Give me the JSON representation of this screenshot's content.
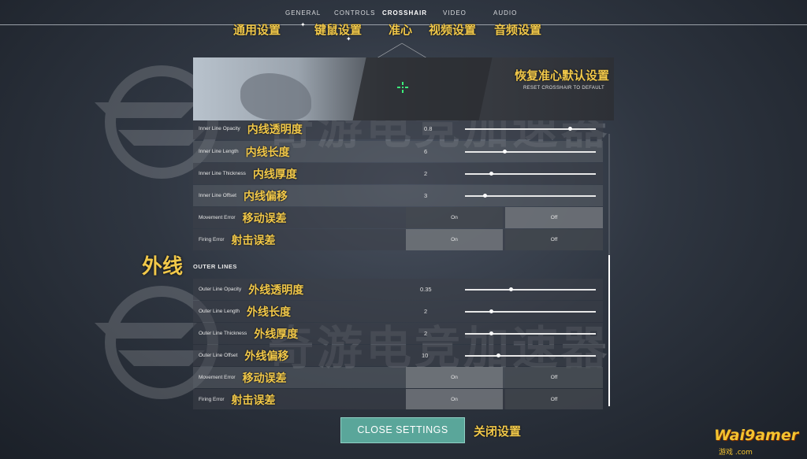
{
  "nav": {
    "tabs": [
      {
        "label": "GENERAL",
        "zh": "通用设置"
      },
      {
        "label": "CONTROLS",
        "zh": "键鼠设置"
      },
      {
        "label": "CROSSHAIR",
        "zh": "准心"
      },
      {
        "label": "VIDEO",
        "zh": "视频设置"
      },
      {
        "label": "AUDIO",
        "zh": "音频设置"
      }
    ],
    "active_tab": "CROSSHAIR"
  },
  "preview": {
    "reset_zh": "恢复准心默认设置",
    "reset_en": "RESET CROSSHAIR TO DEFAULT"
  },
  "inner_rows": [
    {
      "en": "Inner Line Opacity",
      "zh": "内线透明度",
      "value": "0.8",
      "level": 0.8
    },
    {
      "en": "Inner Line Length",
      "zh": "内线长度",
      "value": "6",
      "level": 0.3
    },
    {
      "en": "Inner Line Thickness",
      "zh": "内线厚度",
      "value": "2",
      "level": 0.2
    },
    {
      "en": "Inner Line Offset",
      "zh": "内线偏移",
      "value": "3",
      "level": 0.15
    }
  ],
  "inner_toggles": [
    {
      "en": "Movement Error",
      "zh": "移动误差",
      "on": "On",
      "off": "Off",
      "selected": "Off"
    },
    {
      "en": "Firing Error",
      "zh": "射击误差",
      "on": "On",
      "off": "Off",
      "selected": "On"
    }
  ],
  "outer_section": {
    "zh": "外线",
    "en": "OUTER LINES"
  },
  "outer_rows": [
    {
      "en": "Outer Line Opacity",
      "zh": "外线透明度",
      "value": "0.35",
      "level": 0.35
    },
    {
      "en": "Outer Line Length",
      "zh": "外线长度",
      "value": "2",
      "level": 0.2
    },
    {
      "en": "Outer Line Thickness",
      "zh": "外线厚度",
      "value": "2",
      "level": 0.2
    },
    {
      "en": "Outer Line Offset",
      "zh": "外线偏移",
      "value": "10",
      "level": 0.25
    }
  ],
  "outer_toggles": [
    {
      "en": "Movement Error",
      "zh": "移动误差",
      "on": "On",
      "off": "Off",
      "selected": "On"
    },
    {
      "en": "Firing Error",
      "zh": "射击误差",
      "on": "On",
      "off": "Off",
      "selected": "On"
    }
  ],
  "footer": {
    "close_label": "CLOSE SETTINGS",
    "close_zh": "关闭设置"
  },
  "watermark": {
    "text": "奇游电竞加速器"
  },
  "logo": {
    "text": "Wai9amer",
    "sub": "游戏 .com"
  },
  "colors": {
    "accent": "#f1c84a",
    "button": "#5aa69a"
  }
}
